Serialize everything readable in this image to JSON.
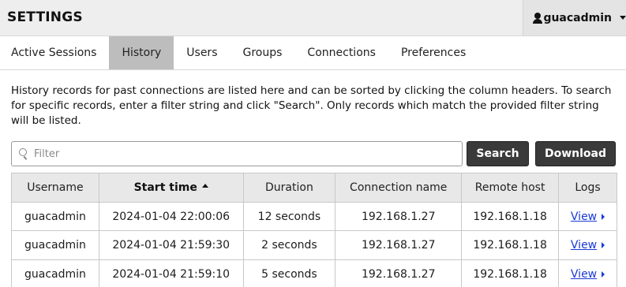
{
  "header": {
    "title": "SETTINGS",
    "username": "guacadmin"
  },
  "tabs": [
    {
      "label": "Active Sessions",
      "active": false
    },
    {
      "label": "History",
      "active": true
    },
    {
      "label": "Users",
      "active": false
    },
    {
      "label": "Groups",
      "active": false
    },
    {
      "label": "Connections",
      "active": false
    },
    {
      "label": "Preferences",
      "active": false
    }
  ],
  "description": "History records for past connections are listed here and can be sorted by clicking the column headers. To search for specific records, enter a filter string and click \"Search\". Only records which match the provided filter string will be listed.",
  "filter": {
    "placeholder": "Filter",
    "value": ""
  },
  "buttons": {
    "search": "Search",
    "download": "Download"
  },
  "table": {
    "columns": [
      "Username",
      "Start time",
      "Duration",
      "Connection name",
      "Remote host",
      "Logs"
    ],
    "sorted_column": "Start time",
    "rows": [
      {
        "username": "guacadmin",
        "start_time": "2024-01-04 22:00:06",
        "duration": "12 seconds",
        "connection": "192.168.1.27",
        "remote_host": "192.168.1.18",
        "logs": "View"
      },
      {
        "username": "guacadmin",
        "start_time": "2024-01-04 21:59:30",
        "duration": "2 seconds",
        "connection": "192.168.1.27",
        "remote_host": "192.168.1.18",
        "logs": "View"
      },
      {
        "username": "guacadmin",
        "start_time": "2024-01-04 21:59:10",
        "duration": "5 seconds",
        "connection": "192.168.1.27",
        "remote_host": "192.168.1.18",
        "logs": "View"
      }
    ]
  },
  "colors": {
    "accent_link": "#1a3ad6",
    "button_bg": "#3a3a3a",
    "active_tab_bg": "#bdbdbd",
    "header_bg": "#eeeeee"
  }
}
